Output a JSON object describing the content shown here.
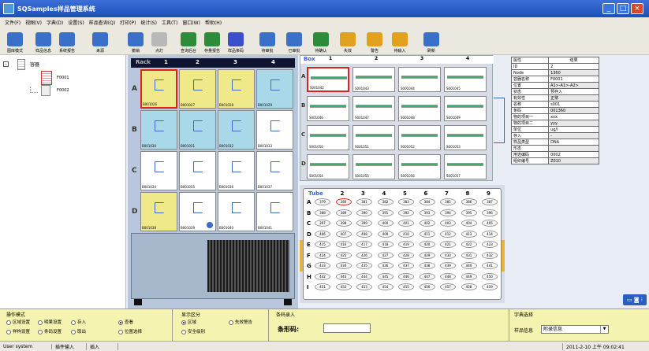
{
  "window": {
    "title": "SQSamples样品管理系统",
    "controls": [
      "_",
      "□",
      "×"
    ]
  },
  "menu": [
    "文件(F)",
    "视图(V)",
    "字典(D)",
    "设置(S)",
    "样品查询(Q)",
    "打印(P)",
    "统计(S)",
    "工具(T)",
    "窗口(W)",
    "帮助(H)"
  ],
  "toolbar": [
    {
      "label": "图库模式",
      "icon": "grid-icon",
      "color": "#3b70c9"
    },
    {
      "label": "样品信息",
      "icon": "sample-icon",
      "color": "#3b70c9"
    },
    {
      "label": "系统报告",
      "icon": "report-icon",
      "color": "#3b70c9"
    },
    {
      "label": "来源",
      "icon": "source-icon",
      "color": "#3b70c9"
    },
    {
      "label": "撤销",
      "icon": "undo-icon",
      "color": "#3b70c9"
    },
    {
      "label": "点灯",
      "icon": "lamp-icon",
      "color": "#b8b8b8"
    },
    {
      "label": "查询后台",
      "icon": "query-icon",
      "color": "#2e8b3a"
    },
    {
      "label": "存量报告",
      "icon": "stock-icon",
      "color": "#2e8b3a"
    },
    {
      "label": "样品条码",
      "icon": "barcode-icon",
      "color": "#3b4fc9"
    },
    {
      "label": "待审批",
      "icon": "pending-icon",
      "color": "#3b70c9"
    },
    {
      "label": "已审批",
      "icon": "approved-icon",
      "color": "#3b70c9"
    },
    {
      "label": "待确认",
      "icon": "confirm-icon",
      "color": "#2e8b3a"
    },
    {
      "label": "失效",
      "icon": "invalid-icon",
      "color": "#e0a020"
    },
    {
      "label": "警告",
      "icon": "warning-icon",
      "color": "#e0a020"
    },
    {
      "label": "待输入",
      "icon": "input-icon",
      "color": "#e0a020"
    },
    {
      "label": "刷新",
      "icon": "refresh-icon",
      "color": "#3b70c9"
    }
  ],
  "tree": {
    "root": "容器",
    "children": [
      "F0001",
      "F0002"
    ]
  },
  "rack": {
    "header": "Rack",
    "cols": [
      "1",
      "2",
      "3",
      "4"
    ],
    "rows": [
      "A",
      "B",
      "C",
      "D"
    ],
    "slots": [
      [
        "B001026",
        "B001027",
        "B001028",
        "B001029"
      ],
      [
        "B001030",
        "B001031",
        "B001032",
        "B001033"
      ],
      [
        "B001034",
        "B001035",
        "B001036",
        "B001037"
      ],
      [
        "B001038",
        "B001039",
        "B001040",
        "B001041"
      ]
    ],
    "colors": [
      [
        "#f0e98a",
        "#f0e98a",
        "#f0e98a",
        "#a9d8e8"
      ],
      [
        "#a9d8e8",
        "#a9d8e8",
        "#a9d8e8",
        "#ffffff"
      ],
      [
        "#ffffff",
        "#ffffff",
        "#ffffff",
        "#ffffff"
      ],
      [
        "#f0e98a",
        "#ffffff",
        "#ffffff",
        "#ffffff"
      ]
    ]
  },
  "box": {
    "header": "Box",
    "cols": [
      "1",
      "2",
      "3",
      "4"
    ],
    "rows": [
      "A",
      "B",
      "C",
      "D"
    ],
    "slots": [
      [
        "S001042",
        "S001043",
        "S001044",
        "S001045"
      ],
      [
        "S001046",
        "S001047",
        "S001048",
        "S001049"
      ],
      [
        "S001050",
        "S001051",
        "S001052",
        "S001053"
      ],
      [
        "S001054",
        "S001055",
        "S001056",
        "S001057"
      ]
    ]
  },
  "tubes": {
    "header": "Tube",
    "cols": [
      "1",
      "2",
      "3",
      "4",
      "5",
      "6",
      "7",
      "8",
      "9"
    ],
    "rows": [
      "A",
      "B",
      "C",
      "D",
      "E",
      "F",
      "G",
      "H",
      "I"
    ],
    "values": [
      [
        "379",
        "380",
        "381",
        "382",
        "383",
        "384",
        "385",
        "386",
        "387"
      ],
      [
        "388",
        "389",
        "390",
        "391",
        "392",
        "393",
        "394",
        "395",
        "396"
      ],
      [
        "397",
        "398",
        "399",
        "400",
        "401",
        "402",
        "403",
        "404",
        "405"
      ],
      [
        "406",
        "407",
        "408",
        "409",
        "410",
        "411",
        "412",
        "413",
        "414"
      ],
      [
        "415",
        "416",
        "417",
        "418",
        "419",
        "420",
        "421",
        "422",
        "423"
      ],
      [
        "424",
        "425",
        "426",
        "427",
        "428",
        "429",
        "430",
        "431",
        "432"
      ],
      [
        "433",
        "434",
        "435",
        "436",
        "437",
        "438",
        "439",
        "440",
        "441"
      ],
      [
        "442",
        "443",
        "444",
        "445",
        "446",
        "447",
        "448",
        "449",
        "450"
      ],
      [
        "451",
        "452",
        "453",
        "454",
        "455",
        "456",
        "457",
        "458",
        "459"
      ]
    ]
  },
  "props": {
    "headers": [
      "属性",
      "结果"
    ],
    "rows": [
      [
        "ID",
        "2"
      ],
      [
        "Node",
        "1360"
      ],
      [
        "容器名称",
        "F0001"
      ],
      [
        "位置",
        "A1>-A1>-A2>"
      ],
      [
        "状态",
        "预存入"
      ],
      [
        "有效性",
        "正常"
      ],
      [
        "名称",
        "s001"
      ],
      [
        "条码",
        "001360"
      ],
      [
        "物的项目一",
        "xxx"
      ],
      [
        "物的项目二",
        "yyy"
      ],
      [
        "单位",
        "ug/l"
      ],
      [
        "存入",
        "-"
      ],
      [
        "样品类型",
        "DNA"
      ],
      [
        "形态",
        ""
      ],
      [
        "用途编码",
        "0002"
      ],
      [
        "组织编号",
        "Z010"
      ]
    ]
  },
  "bottom": {
    "op_title": "操作模式",
    "op_options": [
      "区域设置",
      "明果设置",
      "存入",
      "查看",
      "样构设置",
      "条码设置",
      "取出",
      "位置选择"
    ],
    "display_title": "显示区分",
    "display_options": [
      "区域",
      "失效警告",
      "安全级别"
    ],
    "barcode_title": "条码录入",
    "barcode_label": "条形码:",
    "dict_title": "字典选择",
    "dict_label": "样品信息",
    "dict_value": "附录信息"
  },
  "status": {
    "user": "User system",
    "mode": "插件输入",
    "insert": "插入",
    "datetime": "2011-2-10 上午 09:02:41"
  }
}
